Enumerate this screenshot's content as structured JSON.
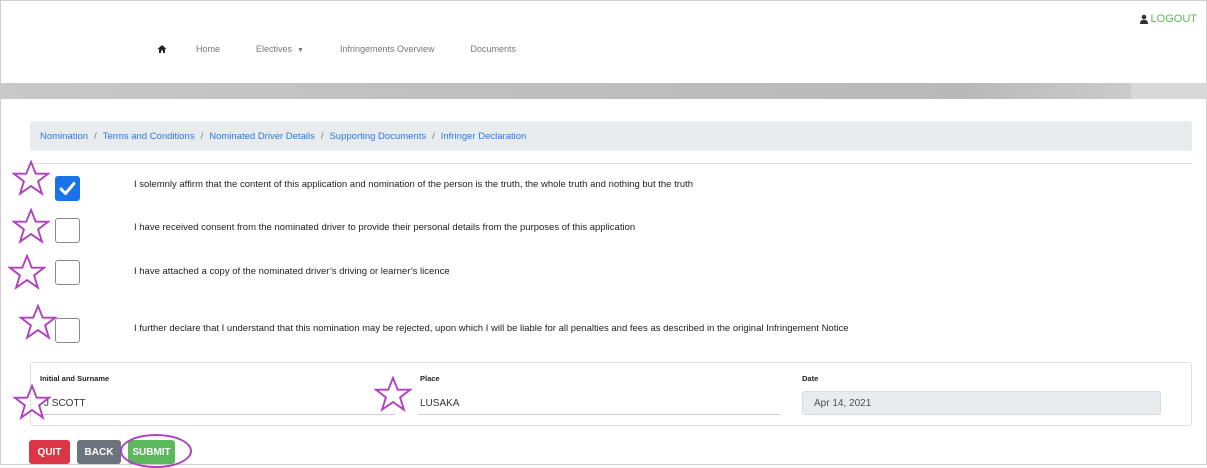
{
  "header": {
    "logout_label": "LOGOUT"
  },
  "nav": {
    "home_icon": "home-icon",
    "items": [
      "Home",
      "Electives",
      "Infringements Overview",
      "Documents"
    ],
    "electives_caret": "▼"
  },
  "breadcrumb": [
    "Nomination",
    "Terms and Conditions",
    "Nominated Driver Details",
    "Supporting Documents",
    "Infringer Declaration"
  ],
  "breadcrumb_separator": "/",
  "declarations": [
    {
      "text": "I solemnly affirm that the content of this application and nomination of the person is the truth, the whole truth and nothing but the truth",
      "checked": true
    },
    {
      "text": "I have received consent from the nominated driver to provide their personal details from the purposes of this application",
      "checked": false
    },
    {
      "text": "I have attached a copy of the nominated driver’s driving or learner’s licence",
      "checked": false
    },
    {
      "text": "I further declare that I understand that this nomination may be rejected, upon which I will be liable for all penalties and fees as described in the original Infringement Notice",
      "checked": false
    }
  ],
  "form": {
    "name_label": "Initial and Surname",
    "name_value": "J SCOTT",
    "place_label": "Place",
    "place_value": "LUSAKA",
    "date_label": "Date",
    "date_value": "Apr 14, 2021"
  },
  "buttons": {
    "quit": "QUIT",
    "back": "BACK",
    "submit": "SUBMIT"
  },
  "colors": {
    "link": "#2a7ae2",
    "checkbox_checked": "#1a73e8",
    "quit": "#dc3545",
    "back": "#6c757d",
    "submit": "#5cb85c",
    "annotation": "#b040c0"
  }
}
